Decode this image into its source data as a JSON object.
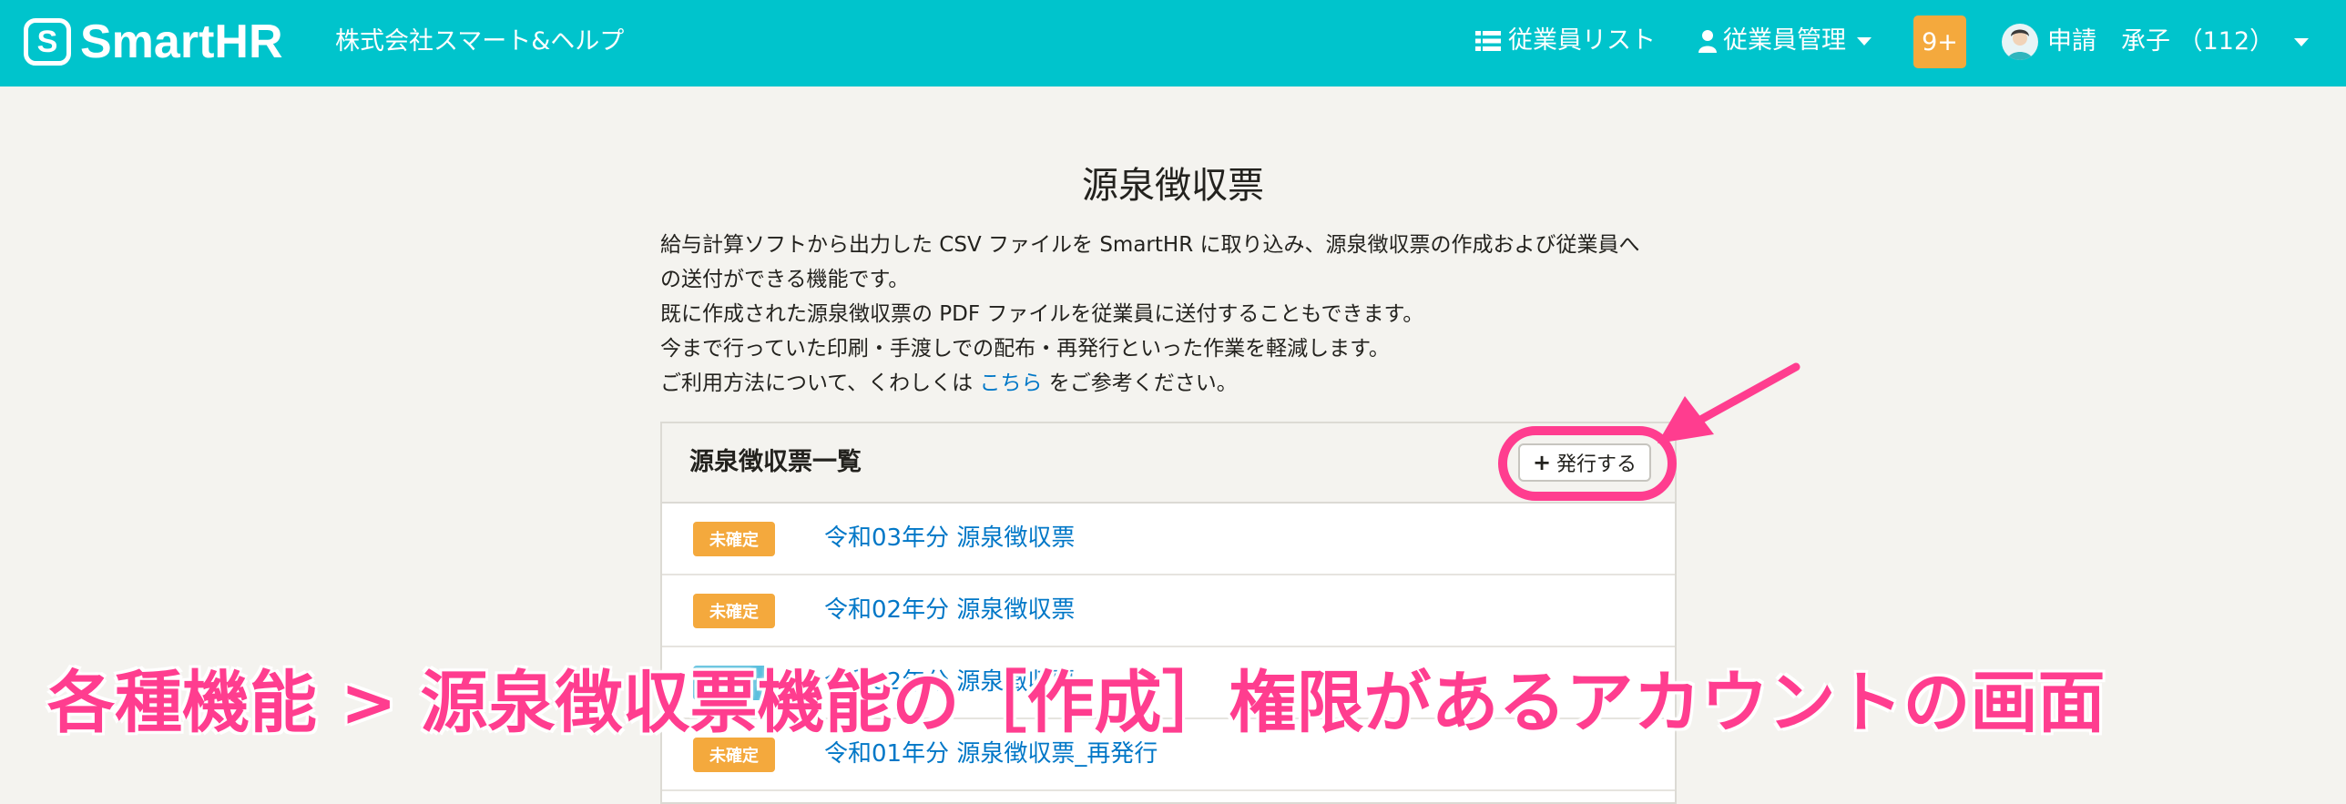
{
  "header": {
    "logo_mark": "S",
    "logo_text": "SmartHR",
    "company": "株式会社スマート&ヘルプ",
    "nav_list": "従業員リスト",
    "nav_management": "従業員管理",
    "notifications": "9+",
    "user_name": "申請　承子 （112）"
  },
  "main": {
    "title": "源泉徴収票",
    "description": [
      "給与計算ソフトから出力した CSV ファイルを SmartHR に取り込み、源泉徴収票の作成および従業員へ",
      "の送付ができる機能です。",
      "既に作成された源泉徴収票の PDF ファイルを従業員に送付することもできます。",
      "今まで行っていた印刷・手渡しでの配布・再発行といった作業を軽減します。"
    ],
    "usage_prefix": "ご利用方法について、くわしくは ",
    "usage_link": "こちら",
    "usage_suffix": " をご参考ください。"
  },
  "panel": {
    "title": "源泉徴収票一覧",
    "issue_button": "発行する",
    "rows": [
      {
        "status": "未確定",
        "status_color": "#f4a93d",
        "label": "令和03年分 源泉徴収票"
      },
      {
        "status": "未確定",
        "status_color": "#f4a93d",
        "label": "令和02年分 源泉徴収票"
      },
      {
        "status": "確定",
        "status_color": "#5bc0de",
        "label": "令和02年分 源泉徴収票"
      },
      {
        "status": "未確定",
        "status_color": "#f4a93d",
        "label": "令和01年分 源泉徴収票_再発行"
      }
    ]
  },
  "annotation": {
    "caption": "各種機能 > 源泉徴収票機能の［作成］権限があるアカウントの画面",
    "highlight_color": "#ff3d8f"
  }
}
